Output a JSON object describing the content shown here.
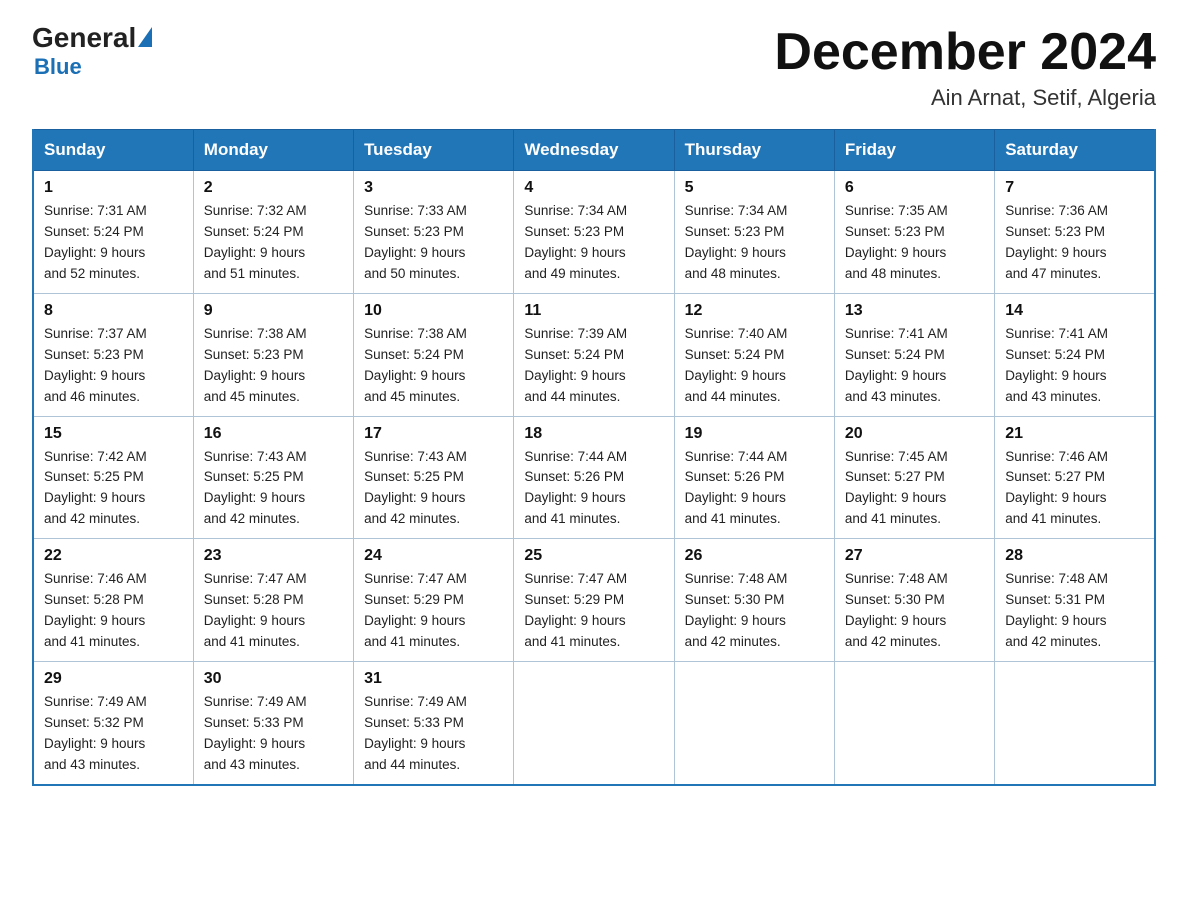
{
  "header": {
    "logo_general": "General",
    "logo_blue": "Blue",
    "month_title": "December 2024",
    "location": "Ain Arnat, Setif, Algeria"
  },
  "days_of_week": [
    "Sunday",
    "Monday",
    "Tuesday",
    "Wednesday",
    "Thursday",
    "Friday",
    "Saturday"
  ],
  "weeks": [
    [
      {
        "day": "1",
        "sunrise": "7:31 AM",
        "sunset": "5:24 PM",
        "daylight": "9 hours and 52 minutes."
      },
      {
        "day": "2",
        "sunrise": "7:32 AM",
        "sunset": "5:24 PM",
        "daylight": "9 hours and 51 minutes."
      },
      {
        "day": "3",
        "sunrise": "7:33 AM",
        "sunset": "5:23 PM",
        "daylight": "9 hours and 50 minutes."
      },
      {
        "day": "4",
        "sunrise": "7:34 AM",
        "sunset": "5:23 PM",
        "daylight": "9 hours and 49 minutes."
      },
      {
        "day": "5",
        "sunrise": "7:34 AM",
        "sunset": "5:23 PM",
        "daylight": "9 hours and 48 minutes."
      },
      {
        "day": "6",
        "sunrise": "7:35 AM",
        "sunset": "5:23 PM",
        "daylight": "9 hours and 48 minutes."
      },
      {
        "day": "7",
        "sunrise": "7:36 AM",
        "sunset": "5:23 PM",
        "daylight": "9 hours and 47 minutes."
      }
    ],
    [
      {
        "day": "8",
        "sunrise": "7:37 AM",
        "sunset": "5:23 PM",
        "daylight": "9 hours and 46 minutes."
      },
      {
        "day": "9",
        "sunrise": "7:38 AM",
        "sunset": "5:23 PM",
        "daylight": "9 hours and 45 minutes."
      },
      {
        "day": "10",
        "sunrise": "7:38 AM",
        "sunset": "5:24 PM",
        "daylight": "9 hours and 45 minutes."
      },
      {
        "day": "11",
        "sunrise": "7:39 AM",
        "sunset": "5:24 PM",
        "daylight": "9 hours and 44 minutes."
      },
      {
        "day": "12",
        "sunrise": "7:40 AM",
        "sunset": "5:24 PM",
        "daylight": "9 hours and 44 minutes."
      },
      {
        "day": "13",
        "sunrise": "7:41 AM",
        "sunset": "5:24 PM",
        "daylight": "9 hours and 43 minutes."
      },
      {
        "day": "14",
        "sunrise": "7:41 AM",
        "sunset": "5:24 PM",
        "daylight": "9 hours and 43 minutes."
      }
    ],
    [
      {
        "day": "15",
        "sunrise": "7:42 AM",
        "sunset": "5:25 PM",
        "daylight": "9 hours and 42 minutes."
      },
      {
        "day": "16",
        "sunrise": "7:43 AM",
        "sunset": "5:25 PM",
        "daylight": "9 hours and 42 minutes."
      },
      {
        "day": "17",
        "sunrise": "7:43 AM",
        "sunset": "5:25 PM",
        "daylight": "9 hours and 42 minutes."
      },
      {
        "day": "18",
        "sunrise": "7:44 AM",
        "sunset": "5:26 PM",
        "daylight": "9 hours and 41 minutes."
      },
      {
        "day": "19",
        "sunrise": "7:44 AM",
        "sunset": "5:26 PM",
        "daylight": "9 hours and 41 minutes."
      },
      {
        "day": "20",
        "sunrise": "7:45 AM",
        "sunset": "5:27 PM",
        "daylight": "9 hours and 41 minutes."
      },
      {
        "day": "21",
        "sunrise": "7:46 AM",
        "sunset": "5:27 PM",
        "daylight": "9 hours and 41 minutes."
      }
    ],
    [
      {
        "day": "22",
        "sunrise": "7:46 AM",
        "sunset": "5:28 PM",
        "daylight": "9 hours and 41 minutes."
      },
      {
        "day": "23",
        "sunrise": "7:47 AM",
        "sunset": "5:28 PM",
        "daylight": "9 hours and 41 minutes."
      },
      {
        "day": "24",
        "sunrise": "7:47 AM",
        "sunset": "5:29 PM",
        "daylight": "9 hours and 41 minutes."
      },
      {
        "day": "25",
        "sunrise": "7:47 AM",
        "sunset": "5:29 PM",
        "daylight": "9 hours and 41 minutes."
      },
      {
        "day": "26",
        "sunrise": "7:48 AM",
        "sunset": "5:30 PM",
        "daylight": "9 hours and 42 minutes."
      },
      {
        "day": "27",
        "sunrise": "7:48 AM",
        "sunset": "5:30 PM",
        "daylight": "9 hours and 42 minutes."
      },
      {
        "day": "28",
        "sunrise": "7:48 AM",
        "sunset": "5:31 PM",
        "daylight": "9 hours and 42 minutes."
      }
    ],
    [
      {
        "day": "29",
        "sunrise": "7:49 AM",
        "sunset": "5:32 PM",
        "daylight": "9 hours and 43 minutes."
      },
      {
        "day": "30",
        "sunrise": "7:49 AM",
        "sunset": "5:33 PM",
        "daylight": "9 hours and 43 minutes."
      },
      {
        "day": "31",
        "sunrise": "7:49 AM",
        "sunset": "5:33 PM",
        "daylight": "9 hours and 44 minutes."
      },
      null,
      null,
      null,
      null
    ]
  ],
  "labels": {
    "sunrise_prefix": "Sunrise: ",
    "sunset_prefix": "Sunset: ",
    "daylight_prefix": "Daylight: "
  }
}
